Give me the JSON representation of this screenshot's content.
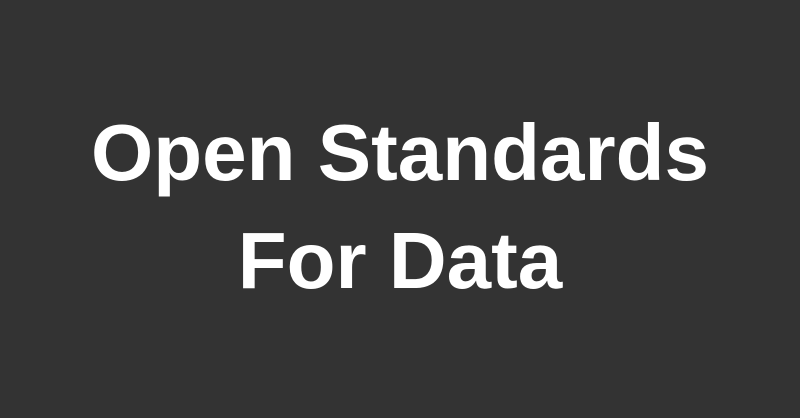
{
  "banner": {
    "title_line_1": "Open Standards",
    "title_line_2": "For Data",
    "background_color": "#333333",
    "text_color": "#ffffff"
  }
}
